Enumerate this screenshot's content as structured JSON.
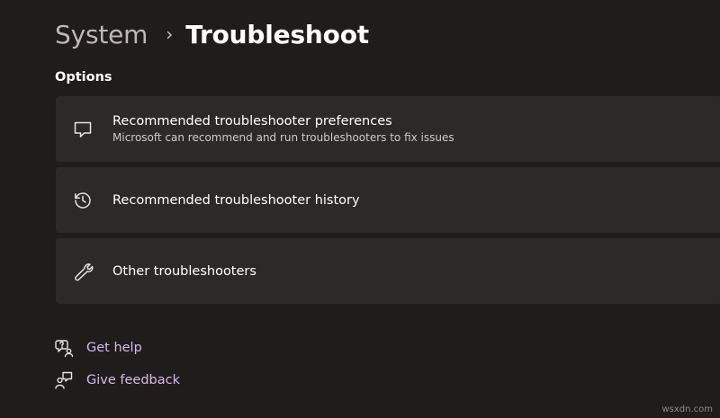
{
  "breadcrumb": {
    "parent": "System",
    "separator": "›",
    "current": "Troubleshoot"
  },
  "section": {
    "title": "Options"
  },
  "cards": [
    {
      "icon": "chat-bubble-icon",
      "title": "Recommended troubleshooter preferences",
      "description": "Microsoft can recommend and run troubleshooters to fix issues"
    },
    {
      "icon": "history-icon",
      "title": "Recommended troubleshooter history"
    },
    {
      "icon": "wrench-icon",
      "title": "Other troubleshooters"
    }
  ],
  "links": [
    {
      "icon": "help-icon",
      "label": "Get help"
    },
    {
      "icon": "feedback-icon",
      "label": "Give feedback"
    }
  ],
  "watermark": "wsxdn.com",
  "colors": {
    "background": "#201c1b",
    "card": "#2d2928",
    "link": "#d9b9e9"
  }
}
